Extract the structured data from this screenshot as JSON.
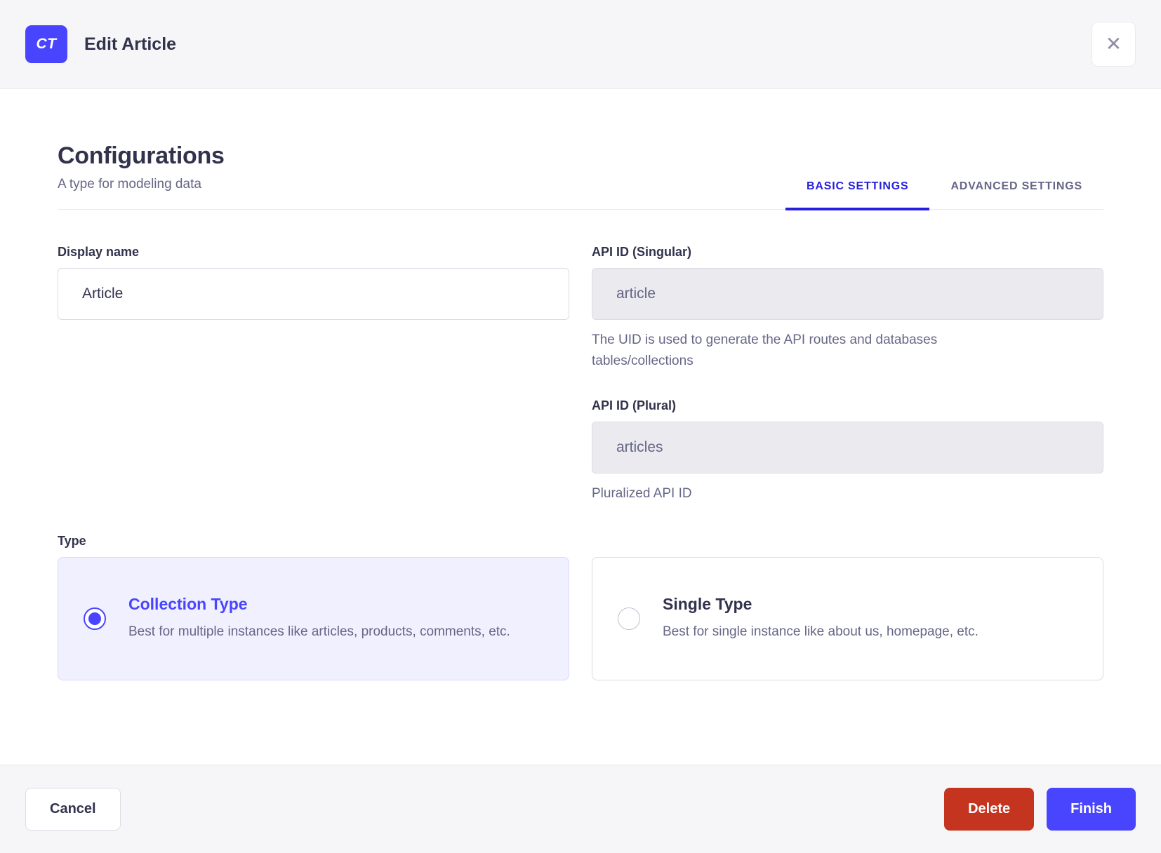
{
  "header": {
    "badge": "CT",
    "title": "Edit Article"
  },
  "icons": {
    "close": "✕"
  },
  "section": {
    "title": "Configurations",
    "subtitle": "A type for modeling data"
  },
  "tabs": [
    {
      "label": "BASIC SETTINGS",
      "active": true
    },
    {
      "label": "ADVANCED SETTINGS",
      "active": false
    }
  ],
  "form": {
    "display_name": {
      "label": "Display name",
      "value": "Article"
    },
    "api_id_singular": {
      "label": "API ID (Singular)",
      "value": "article",
      "hint": "The UID is used to generate the API routes and databases tables/collections"
    },
    "api_id_plural": {
      "label": "API ID (Plural)",
      "value": "articles",
      "hint": "Pluralized API ID"
    },
    "type": {
      "label": "Type",
      "options": [
        {
          "title": "Collection Type",
          "description": "Best for multiple instances like articles, products, comments, etc.",
          "selected": true
        },
        {
          "title": "Single Type",
          "description": "Best for single instance like about us, homepage, etc.",
          "selected": false
        }
      ]
    }
  },
  "footer": {
    "cancel": "Cancel",
    "delete": "Delete",
    "finish": "Finish"
  },
  "colors": {
    "primary": "#4945ff",
    "tab_active": "#271fe0",
    "danger": "#c4341e",
    "selected_card_bg": "#f0f0ff",
    "header_bg": "#f6f6f9",
    "border": "#dcdce4",
    "text_primary": "#32324d",
    "text_secondary": "#666687"
  }
}
